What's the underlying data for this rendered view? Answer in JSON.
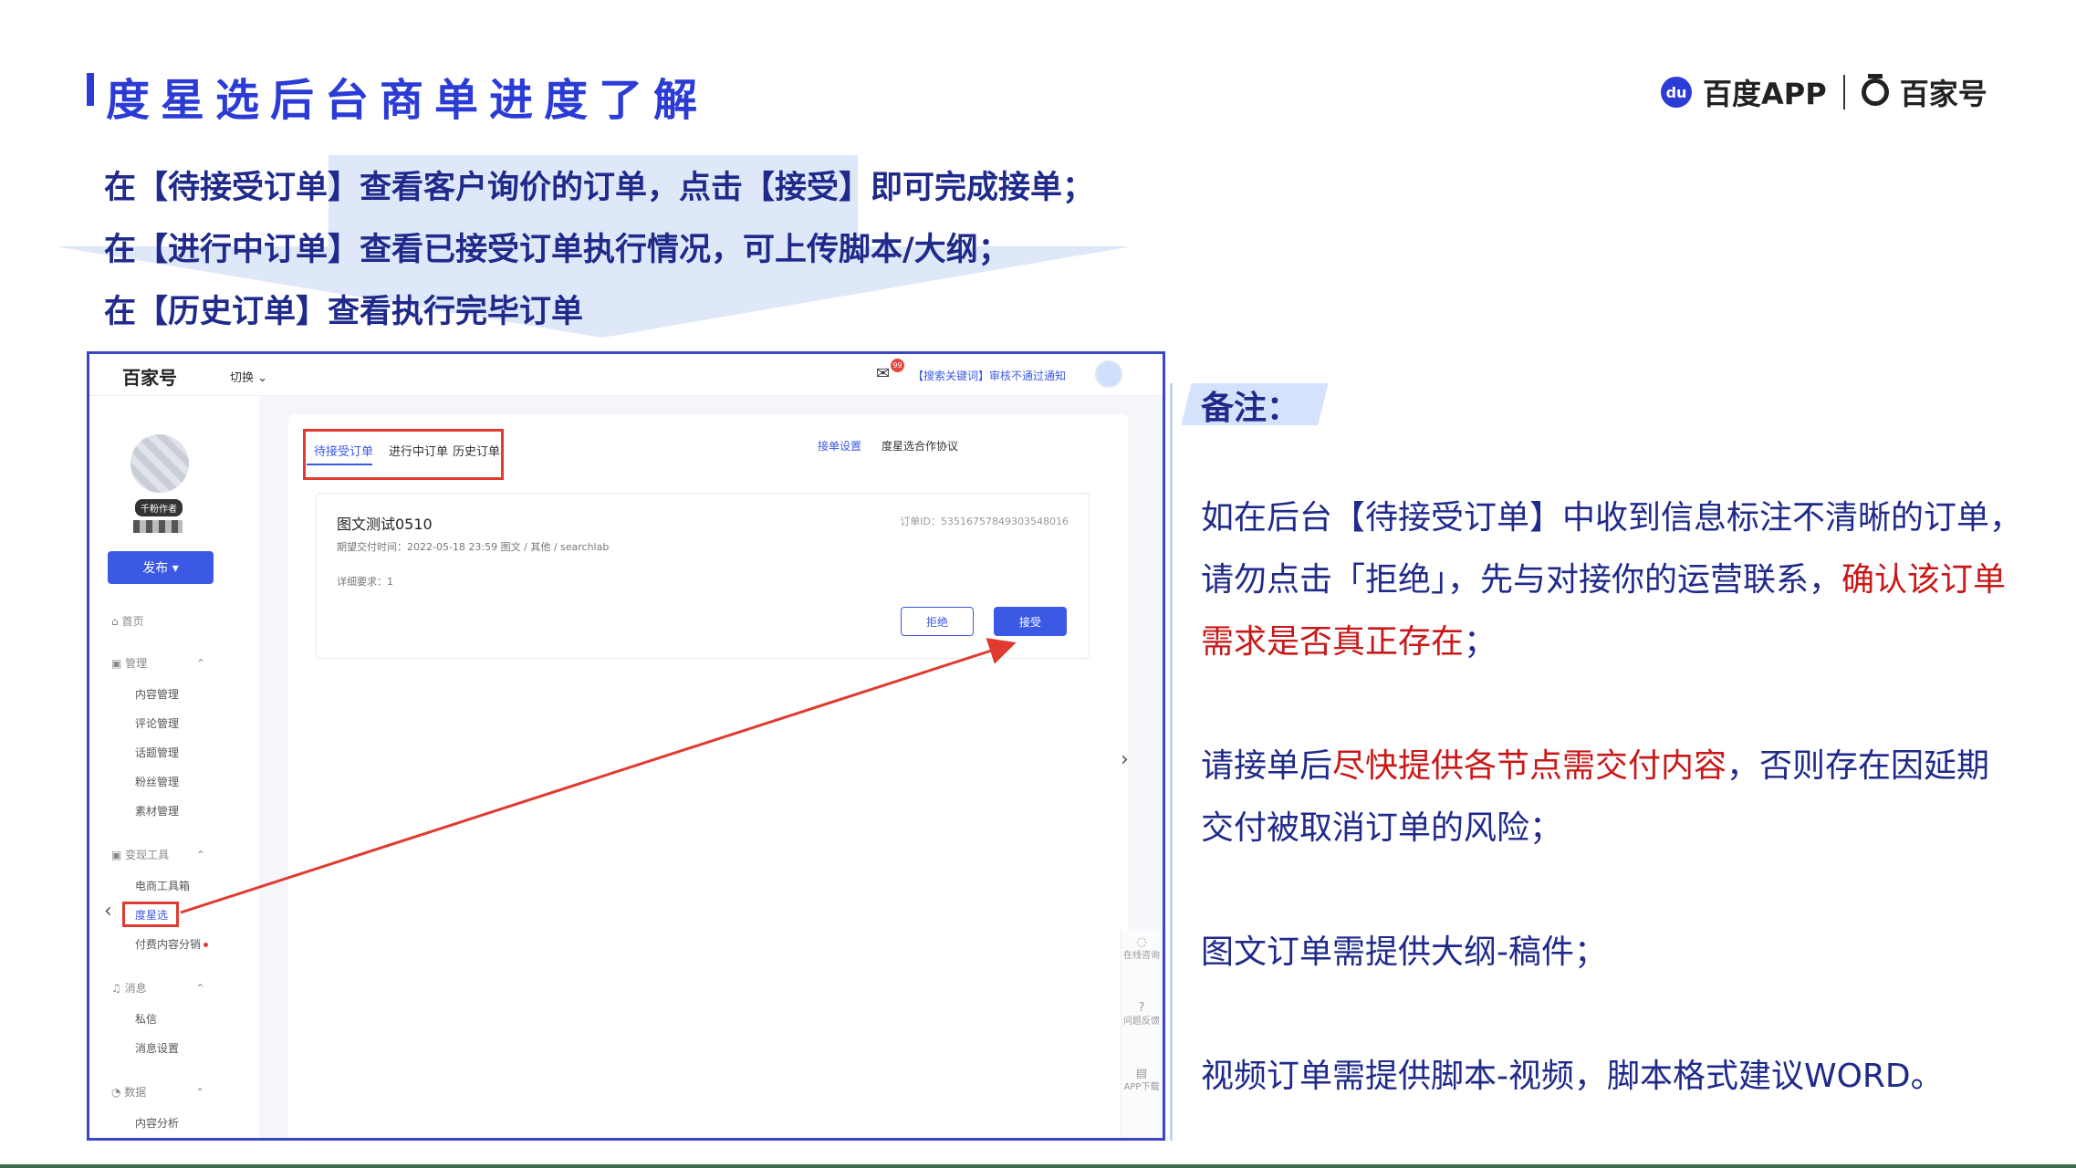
{
  "header": {
    "title": "度星选后台商单进度了解",
    "brand": {
      "baidu_app": "百度APP",
      "baijiahao": "百家号"
    }
  },
  "intro_lines": [
    "在【待接受订单】查看客户询价的订单，点击【接受】即可完成接单；",
    "在【进行中订单】查看已接受订单执行情况，可上传脚本/大纲；",
    "在【历史订单】查看执行完毕订单"
  ],
  "screenshot": {
    "topbar": {
      "logo": "百家号",
      "switch": "切换 ⌄",
      "mail_badge": "99",
      "notice": "【搜索关键词】审核不通过通知"
    },
    "sidebar": {
      "badge": "千粉作者",
      "publish": "发布 ▾",
      "home": "首页",
      "group_manage": "管理",
      "manage_items": [
        "内容管理",
        "评论管理",
        "话题管理",
        "粉丝管理",
        "素材管理"
      ],
      "group_monetize": "变现工具",
      "monetize_items": [
        "电商工具箱",
        "度星选",
        "付费内容分销"
      ],
      "group_message": "消息",
      "message_items": [
        "私信",
        "消息设置"
      ],
      "group_data": "数据",
      "data_items": [
        "内容分析"
      ]
    },
    "tabs": [
      "待接受订单",
      "进行中订单",
      "历史订单"
    ],
    "links": {
      "settings": "接单设置",
      "agreement": "度星选合作协议"
    },
    "order": {
      "title": "图文测试0510",
      "meta": "期望交付时间：2022-05-18 23:59     图文 / 其他 / searchlab",
      "id": "订单ID：5351675784930354801­6",
      "requirement": "详细要求：1",
      "reject": "拒绝",
      "accept": "接受"
    },
    "float": [
      {
        "icon": "chat-icon",
        "label": "在线咨询"
      },
      {
        "icon": "question-icon",
        "label": "问题反馈"
      },
      {
        "icon": "app-icon",
        "label": "APP下载"
      }
    ]
  },
  "remark": {
    "label": "备注：",
    "note1_a": "如在后台【待接受订单】中收到信息标注不清晰的订单，请勿点击「拒绝」，先与对接你的运营联系，",
    "note1_red": "确认该订单需求是否真正存在",
    "note1_b": "；",
    "note2_a": "请接单后",
    "note2_red": "尽快提供各节点需交付内容",
    "note2_b": "，否则存在因延期交付被取消订单的风险；",
    "note3": "图文订单需提供大纲-稿件；",
    "note4": "视频订单需提供脚本-视频，脚本格式建议WORD。"
  },
  "colors": {
    "accent": "#2b3bd6",
    "navy": "#1f2a8a",
    "highlight_red": "#c91818",
    "ui_blue": "#3c59e6",
    "callout_red": "#e03a31"
  }
}
